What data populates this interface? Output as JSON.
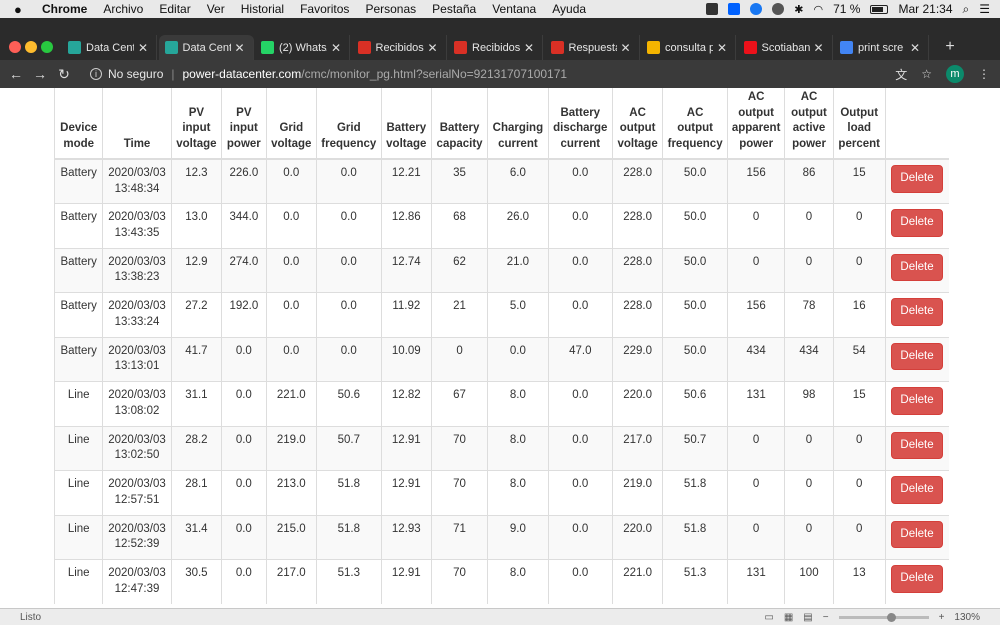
{
  "menubar": {
    "app": "Chrome",
    "items": [
      "Archivo",
      "Editar",
      "Ver",
      "Historial",
      "Favoritos",
      "Personas",
      "Pestaña",
      "Ventana",
      "Ayuda"
    ],
    "battery": "71 %",
    "clock": "Mar 21:34"
  },
  "tabs": [
    {
      "title": "Data Cent",
      "icon": "datacenter-icon",
      "color": "#26a69a",
      "active": false
    },
    {
      "title": "Data Cent",
      "icon": "datacenter-icon",
      "color": "#26a69a",
      "active": true
    },
    {
      "title": "(2) Whats/",
      "icon": "whatsapp-icon",
      "color": "#25d366",
      "active": false
    },
    {
      "title": "Recibidos",
      "icon": "gmail-icon",
      "color": "#d93025",
      "active": false
    },
    {
      "title": "Recibidos",
      "icon": "gmail-icon",
      "color": "#d93025",
      "active": false
    },
    {
      "title": "Respuesta",
      "icon": "gmail-icon",
      "color": "#d93025",
      "active": false
    },
    {
      "title": "consulta p",
      "icon": "sheet-icon",
      "color": "#f4b400",
      "active": false
    },
    {
      "title": "Scotiaban",
      "icon": "scotiabank-icon",
      "color": "#ec111a",
      "active": false
    },
    {
      "title": "print scre",
      "icon": "google-icon",
      "color": "#4285f4",
      "active": false
    }
  ],
  "toolbar": {
    "security": "No seguro",
    "url_host": "power-datacenter.com",
    "url_path": "/cmc/monitor_pg.html?serialNo=92131707100171",
    "avatar": "m"
  },
  "table": {
    "headers": [
      "Device mode",
      "Time",
      "PV input voltage",
      "PV input power",
      "Grid voltage",
      "Grid frequency",
      "Battery voltage",
      "Battery capacity",
      "Charging current",
      "Battery discharge current",
      "AC output voltage",
      "AC output frequency",
      "AC output apparent power",
      "AC output active power",
      "Output load percent",
      ""
    ],
    "delete_label": "Delete",
    "rows": [
      [
        "Battery",
        "2020/03/03 13:48:34",
        "12.3",
        "226.0",
        "0.0",
        "0.0",
        "12.21",
        "35",
        "6.0",
        "0.0",
        "228.0",
        "50.0",
        "156",
        "86",
        "15"
      ],
      [
        "Battery",
        "2020/03/03 13:43:35",
        "13.0",
        "344.0",
        "0.0",
        "0.0",
        "12.86",
        "68",
        "26.0",
        "0.0",
        "228.0",
        "50.0",
        "0",
        "0",
        "0"
      ],
      [
        "Battery",
        "2020/03/03 13:38:23",
        "12.9",
        "274.0",
        "0.0",
        "0.0",
        "12.74",
        "62",
        "21.0",
        "0.0",
        "228.0",
        "50.0",
        "0",
        "0",
        "0"
      ],
      [
        "Battery",
        "2020/03/03 13:33:24",
        "27.2",
        "192.0",
        "0.0",
        "0.0",
        "11.92",
        "21",
        "5.0",
        "0.0",
        "228.0",
        "50.0",
        "156",
        "78",
        "16"
      ],
      [
        "Battery",
        "2020/03/03 13:13:01",
        "41.7",
        "0.0",
        "0.0",
        "0.0",
        "10.09",
        "0",
        "0.0",
        "47.0",
        "229.0",
        "50.0",
        "434",
        "434",
        "54"
      ],
      [
        "Line",
        "2020/03/03 13:08:02",
        "31.1",
        "0.0",
        "221.0",
        "50.6",
        "12.82",
        "67",
        "8.0",
        "0.0",
        "220.0",
        "50.6",
        "131",
        "98",
        "15"
      ],
      [
        "Line",
        "2020/03/03 13:02:50",
        "28.2",
        "0.0",
        "219.0",
        "50.7",
        "12.91",
        "70",
        "8.0",
        "0.0",
        "217.0",
        "50.7",
        "0",
        "0",
        "0"
      ],
      [
        "Line",
        "2020/03/03 12:57:51",
        "28.1",
        "0.0",
        "213.0",
        "51.8",
        "12.91",
        "70",
        "8.0",
        "0.0",
        "219.0",
        "51.8",
        "0",
        "0",
        "0"
      ],
      [
        "Line",
        "2020/03/03 12:52:39",
        "31.4",
        "0.0",
        "215.0",
        "51.8",
        "12.93",
        "71",
        "9.0",
        "0.0",
        "220.0",
        "51.8",
        "0",
        "0",
        "0"
      ],
      [
        "Line",
        "2020/03/03 12:47:39",
        "30.5",
        "0.0",
        "217.0",
        "51.3",
        "12.91",
        "70",
        "8.0",
        "0.0",
        "221.0",
        "51.3",
        "131",
        "100",
        "13"
      ]
    ]
  },
  "statusbar": {
    "status": "Listo",
    "zoom": "130%",
    "zoom_level": 0.6
  }
}
